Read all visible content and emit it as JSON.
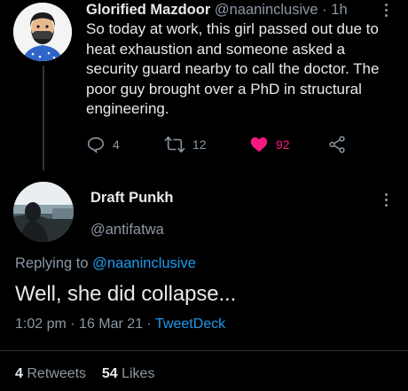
{
  "original_tweet": {
    "display_name": "Glorified Mazdoor",
    "handle": "@naaninclusive",
    "separator": "·",
    "time": "1h",
    "lines": [
      "So today at work, this girl passed out due to",
      "heat exhaustion and someone asked a",
      "security guard nearby to call the doctor. The",
      "poor guy brought over a PhD in structural",
      "engineering."
    ],
    "actions": {
      "replies": "4",
      "retweets": "12",
      "likes": "92"
    }
  },
  "reply_tweet": {
    "display_name": "Draft Punkh",
    "handle": "@antifatwa",
    "replying_prefix": "Replying to",
    "replying_handle": "@naaninclusive",
    "text": "Well, she did collapse...",
    "time": "1:02 pm",
    "separator": "·",
    "date": "16 Mar 21",
    "source": "TweetDeck",
    "retweets_count": "4",
    "retweets_label": "Retweets",
    "likes_count": "54",
    "likes_label": "Likes"
  },
  "colors": {
    "background": "#000000",
    "text": "#e7e9ea",
    "secondary": "#8b98a5",
    "accent": "#1d9bf0",
    "like": "#f91880"
  },
  "icons": [
    "reply-icon",
    "retweet-icon",
    "heart-icon",
    "share-icon",
    "more-icon"
  ]
}
